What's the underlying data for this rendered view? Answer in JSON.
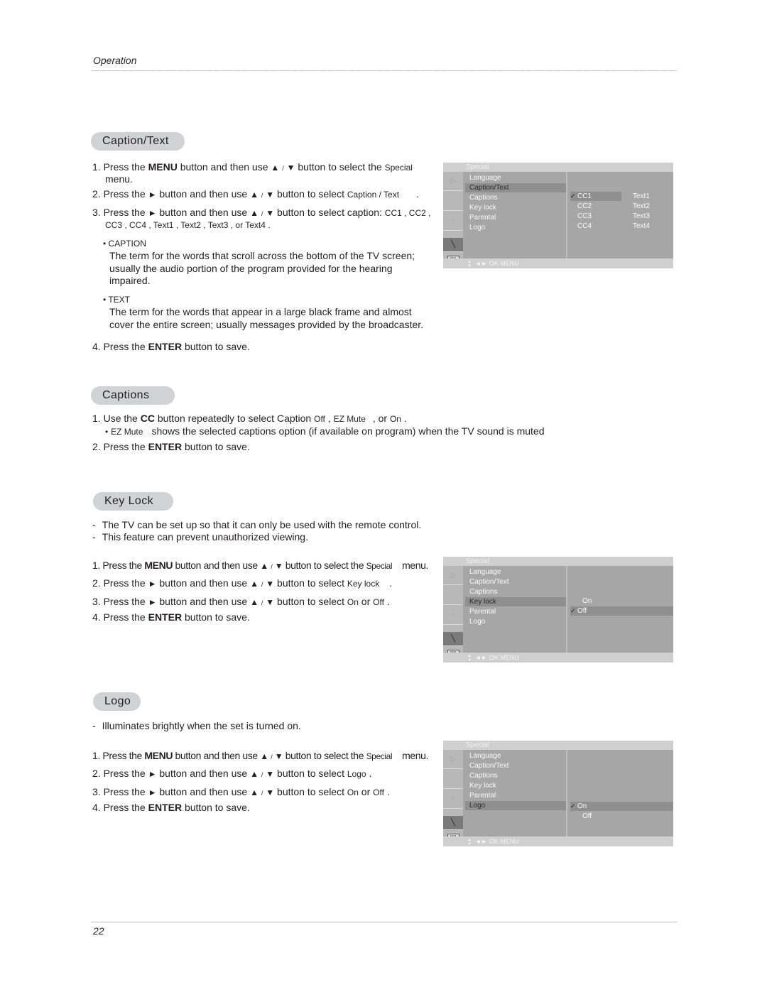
{
  "header": {
    "section": "Operation"
  },
  "footer": {
    "page_number": "22"
  },
  "glyphs": {
    "up": "▲",
    "down": "▼",
    "right": "►",
    "slash": "/",
    "bullet": "•",
    "dash": "-",
    "check": "✓"
  },
  "caption_text": {
    "title": "Caption/Text",
    "steps": [
      {
        "num": "1.",
        "a": "Press the ",
        "b": "MENU",
        "c": " button and then use ",
        "d": " button to select the ",
        "e": "Special",
        "f": "menu."
      },
      {
        "num": "2.",
        "a": "Press the ",
        "c": " button and then use ",
        "d": " button to select ",
        "e": "Caption / Text",
        "f": "."
      },
      {
        "num": "3.",
        "a": "Press the ",
        "c": " button and then use ",
        "d": " button to select caption: ",
        "e": "CC1 , CC2 ,",
        "f": "CC3 , CC4 , Text1 , Text2 , Text3 , or Text4 ."
      },
      {
        "num": "4.",
        "a": "Press the ",
        "b": "ENTER",
        "c": " button to save."
      }
    ],
    "bullets": [
      {
        "label": "CAPTION",
        "lines": [
          "The term for the words that scroll across the bottom of the TV screen;",
          "usually the audio portion of the program provided for the hearing",
          "impaired."
        ]
      },
      {
        "label": "TEXT",
        "lines": [
          "The term for the words that appear in a large black frame and almost",
          "cover the entire screen; usually messages provided by the broadcaster."
        ]
      }
    ]
  },
  "captions": {
    "title": "Captions",
    "step1": {
      "num": "1.",
      "a": "Use the ",
      "b": "CC",
      "c": " button repeatedly to select Caption ",
      "o1": "Off",
      "s1": " , ",
      "o2": "EZ Mute",
      "s2": " , or ",
      "o3": "On",
      "s3": " ."
    },
    "note": {
      "term": "EZ Mute",
      "text": "shows the selected captions option (if available on program) when the TV sound is muted"
    },
    "step2": {
      "num": "2.",
      "a": "Press the ",
      "b": "ENTER",
      "c": " button to save."
    }
  },
  "key_lock": {
    "title": "Key Lock",
    "intro": [
      "The TV can be set up so that it can only be used with the remote control.",
      "This feature can prevent unauthorized viewing."
    ],
    "steps": [
      {
        "num": "1.",
        "a": "Press the ",
        "b": "MENU",
        "c": " button and then use ",
        "d": " button to select the ",
        "e": "Special",
        "f": "menu."
      },
      {
        "num": "2.",
        "a": "Press the ",
        "c": " button and then use ",
        "d": " button to select ",
        "e": "Key lock",
        "f": "."
      },
      {
        "num": "3.",
        "a": "Press the ",
        "c": " button and then use ",
        "d": " button to select ",
        "e": "On",
        "g": " or ",
        "h": "Off",
        "f": "."
      },
      {
        "num": "4.",
        "a": "Press the ",
        "b": "ENTER",
        "c": " button to save."
      }
    ]
  },
  "logo": {
    "title": "Logo",
    "intro": [
      "Illuminates brightly when the set is turned on."
    ],
    "steps": [
      {
        "num": "1.",
        "a": "Press the ",
        "b": "MENU",
        "c": " button and then use ",
        "d": " button to select the ",
        "e": "Special",
        "f": "menu."
      },
      {
        "num": "2.",
        "a": "Press the ",
        "c": " button and then use ",
        "d": " button to select ",
        "e": "Logo",
        "f": "."
      },
      {
        "num": "3.",
        "a": "Press the ",
        "c": " button and then use ",
        "d": " button to select ",
        "e": "On",
        "g": " or ",
        "h": "Off",
        "f": "."
      },
      {
        "num": "4.",
        "a": "Press the ",
        "b": "ENTER",
        "c": " button to save."
      }
    ]
  },
  "osd": {
    "title": "Special",
    "menu_items": [
      "Language",
      "Caption/Text",
      "Captions",
      "Key lock",
      "Parental",
      "Logo"
    ],
    "nav_hint": "◄► OK  MENU",
    "caption_menu": {
      "selected_item": "Caption/Text",
      "options_col1": [
        "CC1",
        "CC2",
        "CC3",
        "CC4"
      ],
      "options_col2": [
        "Text1",
        "Text2",
        "Text3",
        "Text4"
      ],
      "checked": "CC1"
    },
    "keylock_menu": {
      "selected_item": "Key lock",
      "options": [
        "On",
        "Off"
      ],
      "checked": "Off"
    },
    "logo_menu": {
      "selected_item": "Logo",
      "options": [
        "On",
        "Off"
      ],
      "checked": "On"
    }
  },
  "colors": {
    "pill_bg": "#d1d2d4",
    "osd_bg": "#a6a6a6",
    "osd_bar": "#cfcfcf",
    "osd_highlight": "#8f8f8f",
    "text": "#231f20"
  }
}
